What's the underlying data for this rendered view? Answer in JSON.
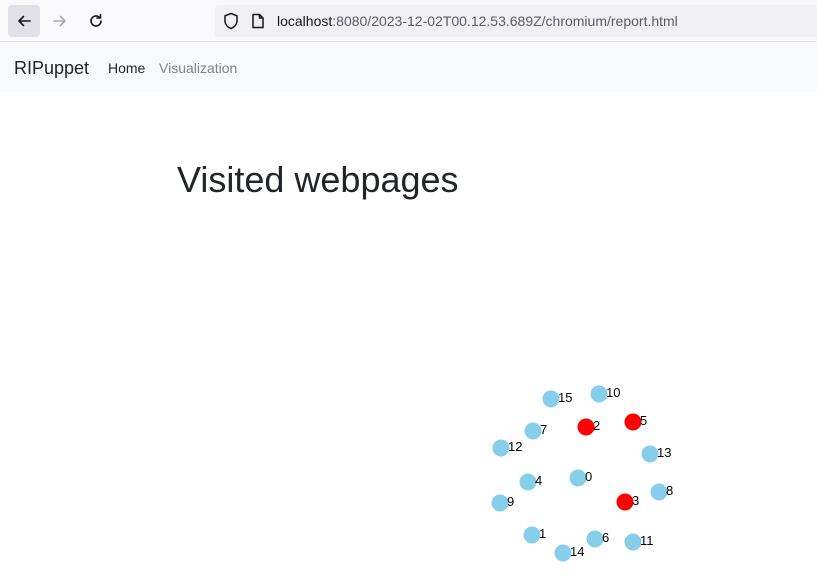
{
  "browser": {
    "url_host": "localhost",
    "url_rest": ":8080/2023-12-02T00.12.53.689Z/chromium/report.html"
  },
  "navbar": {
    "brand": "RIPuppet",
    "links": [
      {
        "label": "Home",
        "active": true
      },
      {
        "label": "Visualization",
        "active": false
      }
    ]
  },
  "main": {
    "title": "Visited webpages"
  },
  "graph": {
    "colors": {
      "visited": "#87ceeb",
      "highlighted": "#ff0000"
    },
    "nodes": [
      {
        "id": "0",
        "color": "visited"
      },
      {
        "id": "1",
        "color": "visited"
      },
      {
        "id": "2",
        "color": "highlighted"
      },
      {
        "id": "3",
        "color": "highlighted"
      },
      {
        "id": "4",
        "color": "visited"
      },
      {
        "id": "5",
        "color": "highlighted"
      },
      {
        "id": "6",
        "color": "visited"
      },
      {
        "id": "7",
        "color": "visited"
      },
      {
        "id": "8",
        "color": "visited"
      },
      {
        "id": "9",
        "color": "visited"
      },
      {
        "id": "10",
        "color": "visited"
      },
      {
        "id": "11",
        "color": "visited"
      },
      {
        "id": "12",
        "color": "visited"
      },
      {
        "id": "13",
        "color": "visited"
      },
      {
        "id": "14",
        "color": "visited"
      },
      {
        "id": "15",
        "color": "visited"
      }
    ]
  }
}
